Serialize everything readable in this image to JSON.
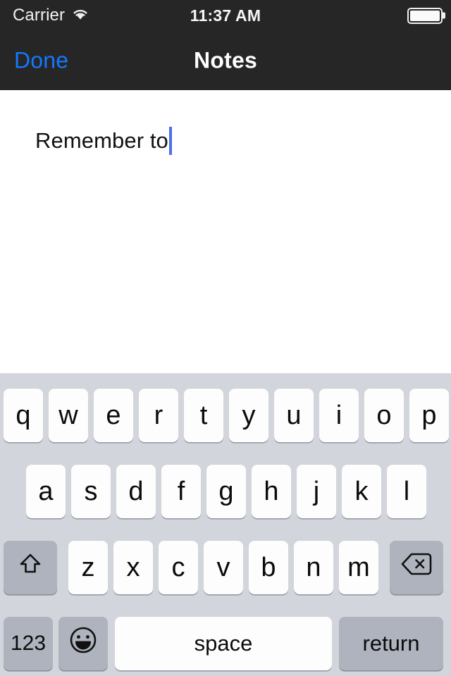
{
  "status_bar": {
    "carrier": "Carrier",
    "wifi_icon": "wifi-icon",
    "time": "11:37 AM",
    "battery_icon": "battery-icon",
    "battery_level_percent": 100,
    "background_color": "#262626",
    "text_color": "#F2F2F2"
  },
  "nav_bar": {
    "done_label": "Done",
    "title": "Notes",
    "accent_color": "#1478FF",
    "background_color": "#262626"
  },
  "note": {
    "text": "Remember to",
    "caret_visible": true,
    "caret_color": "#4A6FE8",
    "background_color": "#FFFFFF"
  },
  "keyboard": {
    "background_color": "#D2D5DB",
    "key_color": "#FDFDFD",
    "special_key_color": "#AEB3BD",
    "layout": "qwerty-lowercase",
    "row1": [
      "q",
      "w",
      "e",
      "r",
      "t",
      "y",
      "u",
      "i",
      "o",
      "p"
    ],
    "row2": [
      "a",
      "s",
      "d",
      "f",
      "g",
      "h",
      "j",
      "k",
      "l"
    ],
    "row3_letters": [
      "z",
      "x",
      "c",
      "v",
      "b",
      "n",
      "m"
    ],
    "shift_icon": "shift-arrow-icon",
    "backspace_icon": "backspace-delete-icon",
    "numbers_label": "123",
    "emoji_icon": "smiley-face-icon",
    "space_label": "space",
    "return_label": "return"
  }
}
